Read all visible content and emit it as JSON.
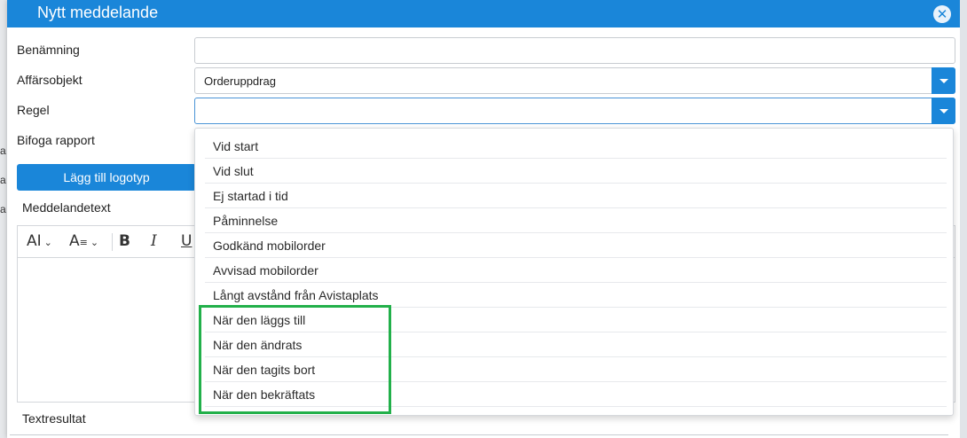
{
  "dialog": {
    "title": "Nytt meddelande"
  },
  "form": {
    "benamning_label": "Benämning",
    "benamning_value": "",
    "affarsobjekt_label": "Affärsobjekt",
    "affarsobjekt_value": "Orderuppdrag",
    "regel_label": "Regel",
    "regel_value": "",
    "bifoga_label": "Bifoga rapport",
    "logo_button": "Lägg till logotyp",
    "meddelandetext_label": "Meddelandetext",
    "textresultat_label": "Textresultat"
  },
  "toolbar": {
    "font_size": "AI",
    "font_style": "A",
    "bold": "B",
    "italic": "I",
    "underline": "U"
  },
  "regel_options": [
    "Vid start",
    "Vid slut",
    "Ej startad i tid",
    "Påminnelse",
    "Godkänd mobilorder",
    "Avvisad mobilorder",
    "Långt avstånd från Avistaplats",
    "När den läggs till",
    "När den ändrats",
    "När den tagits bort",
    "När den bekräftats"
  ],
  "highlighted_options": [
    "När den läggs till",
    "När den ändrats",
    "När den tagits bort",
    "När den bekräftats"
  ],
  "background": {
    "partial_letters": [
      "a",
      "a",
      "a"
    ]
  },
  "colors": {
    "accent": "#1a86d9",
    "highlight": "#22b04a"
  }
}
